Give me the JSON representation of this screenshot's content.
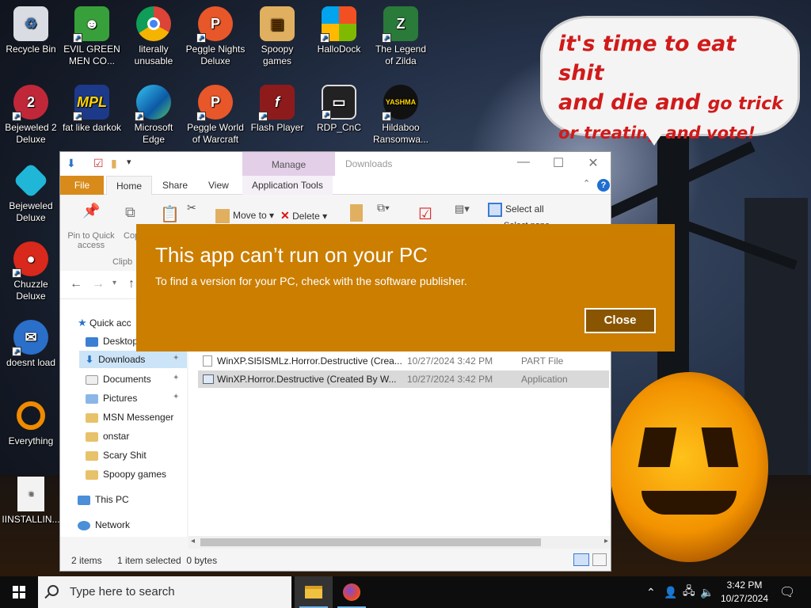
{
  "wallpaper": {
    "bubble": {
      "line1": "it's time to eat shit",
      "line2a": "and die and",
      "line2b": "go trick",
      "line3": "or treating and vote!"
    }
  },
  "desktop_icons": [
    {
      "label": "Recycle Bin",
      "icon": "recycle-bin-icon"
    },
    {
      "label": "EVIL GREEN MEN CO...",
      "icon": "people-icon"
    },
    {
      "label": "literally unusable",
      "icon": "chrome-icon"
    },
    {
      "label": "Peggle Nights Deluxe",
      "icon": "peggle-icon"
    },
    {
      "label": "Spoopy games",
      "icon": "folder-icon"
    },
    {
      "label": "HalloDock",
      "icon": "windows-logo-icon"
    },
    {
      "label": "The Legend of Zilda",
      "icon": "zilda-icon"
    },
    {
      "label": "Bejeweled 2 Deluxe",
      "icon": "gem-icon"
    },
    {
      "label": "fat like darkok",
      "icon": "mpl-icon"
    },
    {
      "label": "Microsoft Edge",
      "icon": "edge-icon"
    },
    {
      "label": "Peggle World of Warcraft",
      "icon": "peggle-icon"
    },
    {
      "label": "Flash Player",
      "icon": "flash-icon"
    },
    {
      "label": "RDP_CnC",
      "icon": "rdp-icon"
    },
    {
      "label": "Hildaboo Ransomwa...",
      "icon": "ransomware-icon"
    },
    {
      "label": "Bejeweled Deluxe",
      "icon": "diamond-icon"
    },
    {
      "label": "Chuzzle Deluxe",
      "icon": "chuzzle-icon"
    },
    {
      "label": "doesnt load",
      "icon": "thunderbird-icon"
    },
    {
      "label": "Everything",
      "icon": "search-icon"
    },
    {
      "label": "IINSTALLIN...",
      "icon": "text-file-icon"
    }
  ],
  "explorer": {
    "title": "Downloads",
    "manage_tab": "Manage",
    "tabs": {
      "file": "File",
      "home": "Home",
      "share": "Share",
      "view": "View",
      "app_tools": "Application Tools"
    },
    "ribbon": {
      "pin_quick_access": "Pin to Quick access",
      "copy": "Cop",
      "clipboard": "Clipb",
      "move_to": "Move to",
      "delete": "Delete",
      "select_all": "Select all",
      "select_none": "Select none"
    },
    "nav": {
      "quick_access": "Quick acc",
      "items": [
        "Desktop",
        "Downloads",
        "Documents",
        "Pictures",
        "MSN Messenger",
        "onstar",
        "Scary Shit",
        "Spoopy games"
      ],
      "this_pc": "This PC",
      "network": "Network"
    },
    "files": [
      {
        "name": "WinXP.SI5ISMLz.Horror.Destructive (Crea...",
        "date": "10/27/2024 3:42 PM",
        "type": "PART File"
      },
      {
        "name": "WinXP.Horror.Destructive (Created By W...",
        "date": "10/27/2024 3:42 PM",
        "type": "Application"
      }
    ],
    "status": {
      "items": "2 items",
      "selected": "1 item selected  0 bytes"
    }
  },
  "dialog": {
    "title": "This app can’t run on your PC",
    "message": "To find a version for your PC, check with the software publisher.",
    "close_label": "Close",
    "color": "#cb7e00"
  },
  "taskbar": {
    "search_placeholder": "Type here to search",
    "time": "3:42 PM",
    "date": "10/27/2024"
  }
}
